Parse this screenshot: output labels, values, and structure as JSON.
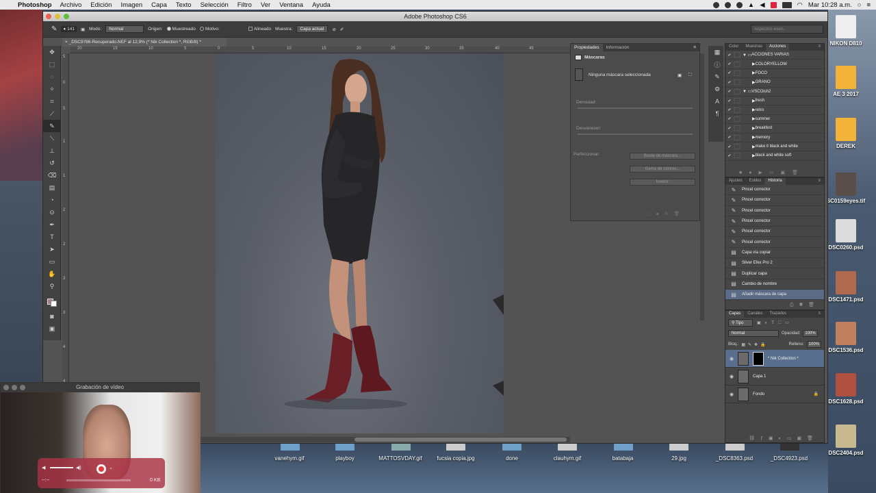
{
  "menubar": {
    "apple": "",
    "app": "Photoshop",
    "items": [
      "Archivo",
      "Edición",
      "Imagen",
      "Capa",
      "Texto",
      "Selección",
      "Filtro",
      "Ver",
      "Ventana",
      "Ayuda"
    ],
    "clock": "Mar 10:28 a.m."
  },
  "window": {
    "title": "Adobe Photoshop CS6"
  },
  "options": {
    "brush_size": "141",
    "mode_label": "Modo:",
    "mode_value": "Normal",
    "origin_label": "Origen:",
    "sampled": "Muestreado",
    "pattern": "Motivo:",
    "aligned": "Alineado",
    "sample_label": "Muestra:",
    "sample_value": "Capa actual",
    "workspace": "Aspectos esen."
  },
  "document": {
    "tab": "_DSC9786-Recuperado.NEF al 12,9% (* Nik Collection *, RGB/8) *",
    "ruler_h": [
      "20",
      "15",
      "10",
      "5",
      "0",
      "5",
      "10",
      "15",
      "20",
      "25",
      "30",
      "35",
      "40",
      "45"
    ],
    "ruler_v": [
      "5",
      "0",
      "5",
      "1",
      "1",
      "2",
      "2",
      "3",
      "3",
      "4",
      "4",
      "5"
    ]
  },
  "properties": {
    "tabs": [
      "Propiedades",
      "Información"
    ],
    "header": "Máscaras",
    "no_mask": "Ninguna máscara seleccionada",
    "density": "Densidad:",
    "feather": "Desvanecer:",
    "refine": "Perfeccionar:",
    "buttons": [
      "Borde de máscara...",
      "Gama de colores...",
      "Invertir"
    ]
  },
  "actions": {
    "tabs": [
      "Color",
      "Muestras",
      "Acciones"
    ],
    "items": [
      {
        "label": "ACCIONES VARIAS",
        "type": "folder"
      },
      {
        "label": "COLORYELLOW",
        "type": "action"
      },
      {
        "label": "FOCO",
        "type": "action"
      },
      {
        "label": "GRANO",
        "type": "action"
      },
      {
        "label": "VSCOish2",
        "type": "folder"
      },
      {
        "label": "fresh",
        "type": "action"
      },
      {
        "label": "retro",
        "type": "action"
      },
      {
        "label": "summer",
        "type": "action"
      },
      {
        "label": "breakfest",
        "type": "action"
      },
      {
        "label": "memory",
        "type": "action"
      },
      {
        "label": "make it black and white",
        "type": "action"
      },
      {
        "label": "black and white soft",
        "type": "action"
      }
    ]
  },
  "history": {
    "tabs": [
      "Ajustes",
      "Estilos",
      "Historia"
    ],
    "items": [
      "Pincel corrector",
      "Pincel corrector",
      "Pincel corrector",
      "Pincel corrector",
      "Pincel corrector",
      "Pincel corrector",
      "Capa vía copiar",
      "Silver Efex Pro 2",
      "Duplicar capa",
      "Cambio de nombre",
      "Añadir máscara de capa"
    ]
  },
  "layers": {
    "tabs": [
      "Capas",
      "Canales",
      "Trazados"
    ],
    "filter": "Tipo",
    "blend": "Normal",
    "opacity_label": "Opacidad:",
    "opacity": "100%",
    "lock_label": "Bloq.:",
    "fill_label": "Relleno:",
    "fill": "100%",
    "items": [
      "* Nik Collection *",
      "Capa 1",
      "Fondo"
    ]
  },
  "desktop": {
    "right_icons": [
      "NIKON D810",
      "AE 3 2017",
      "DEREK",
      "SC0159eyes.tif",
      "DSC0260.psd",
      "DSC1471.psd",
      "DSC1536.psd",
      "DSC1628.psd",
      "DSC2404.psd"
    ],
    "bottom_files": [
      "vanehym.gif",
      "playboy",
      "MATTOSVDAY.gif",
      "fucsia copia.jpg",
      "done",
      "clauhym.gif",
      "batabaja",
      "29.jpg",
      "_DSC8363.psd",
      "_DSC4923.psd"
    ]
  },
  "video": {
    "title": "Grabación de vídeo",
    "time": "--:--",
    "size": "0 KB"
  },
  "colors": {
    "menubar": "#e9e9e9",
    "ps_bg": "#535353",
    "selection": "#5a6f8e",
    "record": "#e23b3b"
  }
}
